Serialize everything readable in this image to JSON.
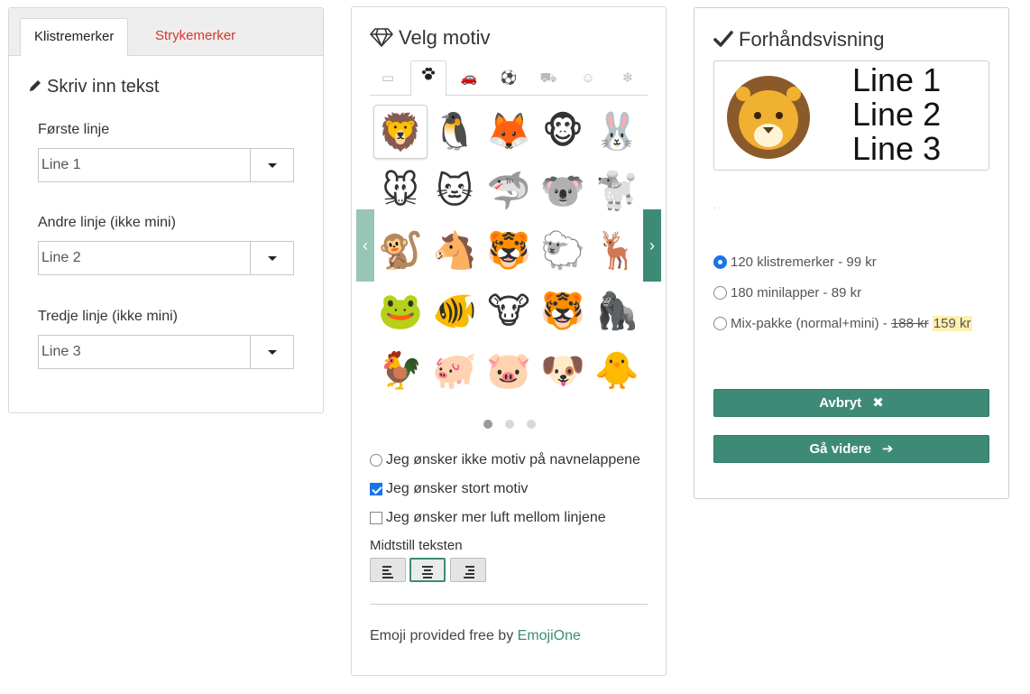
{
  "left": {
    "tabs": [
      {
        "label": "Klistremerker"
      },
      {
        "label": "Strykemerker"
      }
    ],
    "section_title": "Skriv inn tekst",
    "fields": [
      {
        "label": "Første linje",
        "value": "Line 1"
      },
      {
        "label": "Andre linje (ikke mini)",
        "value": "Line 2"
      },
      {
        "label": "Tredje linje (ikke mini)",
        "value": "Line 3"
      }
    ]
  },
  "middle": {
    "title": "Velg motiv",
    "category_tabs": [
      {
        "icon": "image-icon",
        "glyph": "🖼"
      },
      {
        "icon": "paw-icon",
        "glyph": "🐾"
      },
      {
        "icon": "car-icon",
        "glyph": "🚗"
      },
      {
        "icon": "soccer-ball-icon",
        "glyph": "⚽"
      },
      {
        "icon": "vehicle-icon",
        "glyph": "🚙"
      },
      {
        "icon": "smiley-icon",
        "glyph": "😁"
      },
      {
        "icon": "snowflake-icon",
        "glyph": "❄"
      }
    ],
    "emojis": [
      [
        "lion",
        "🦁"
      ],
      [
        "penguin",
        "🐧"
      ],
      [
        "fox",
        "🦊"
      ],
      [
        "monkey-face",
        "🐵"
      ],
      [
        "rabbit",
        "🐰"
      ],
      [
        "mouse",
        "🐭"
      ],
      [
        "cat",
        "🐱"
      ],
      [
        "shark",
        "🦈"
      ],
      [
        "koala",
        "🐨"
      ],
      [
        "poodle",
        "🐩"
      ],
      [
        "monkey",
        "🐒"
      ],
      [
        "horse",
        "🐴"
      ],
      [
        "tiger",
        "🐯"
      ],
      [
        "sheep",
        "🐑"
      ],
      [
        "deer",
        "🦌"
      ],
      [
        "frog",
        "🐸"
      ],
      [
        "clownfish",
        "🐠"
      ],
      [
        "cow",
        "🐮"
      ],
      [
        "tiger-cub",
        "🐯"
      ],
      [
        "gorilla",
        "🦍"
      ],
      [
        "rooster",
        "🐓"
      ],
      [
        "pig",
        "🐖"
      ],
      [
        "pig-face",
        "🐷"
      ],
      [
        "pug",
        "🐶"
      ],
      [
        "chick",
        "🐥"
      ]
    ],
    "options": [
      {
        "label": "Jeg ønsker ikke motiv på navnelappene",
        "checked": false
      },
      {
        "label": "Jeg ønsker stort motiv",
        "checked": true
      },
      {
        "label": "Jeg ønsker mer luft mellom linjene",
        "checked": false
      }
    ],
    "align_label": "Midtstill teksten",
    "credit_prefix": "Emoji provided free by ",
    "credit_link": "EmojiOne"
  },
  "right": {
    "title": "Forhåndsvisning",
    "preview_lines": [
      "Line 1",
      "Line 2",
      "Line 3"
    ],
    "tiny_mark": ".",
    "prices": [
      {
        "text": "120 klistremerker - 99 kr",
        "selected": true
      },
      {
        "text": "180 minilapper - 89 kr",
        "selected": false
      },
      {
        "text": "Mix-pakke (normal+mini) - ",
        "old": "188 kr",
        "new": "159 kr",
        "selected": false
      }
    ],
    "cancel_label": "Avbryt",
    "next_label": "Gå videre"
  },
  "colors": {
    "accent": "#3d8b77",
    "accent_light": "#97c5b8",
    "inactive_tab": "#d9362b",
    "check_blue": "#1a73e8",
    "highlight": "#fdf0b0"
  }
}
